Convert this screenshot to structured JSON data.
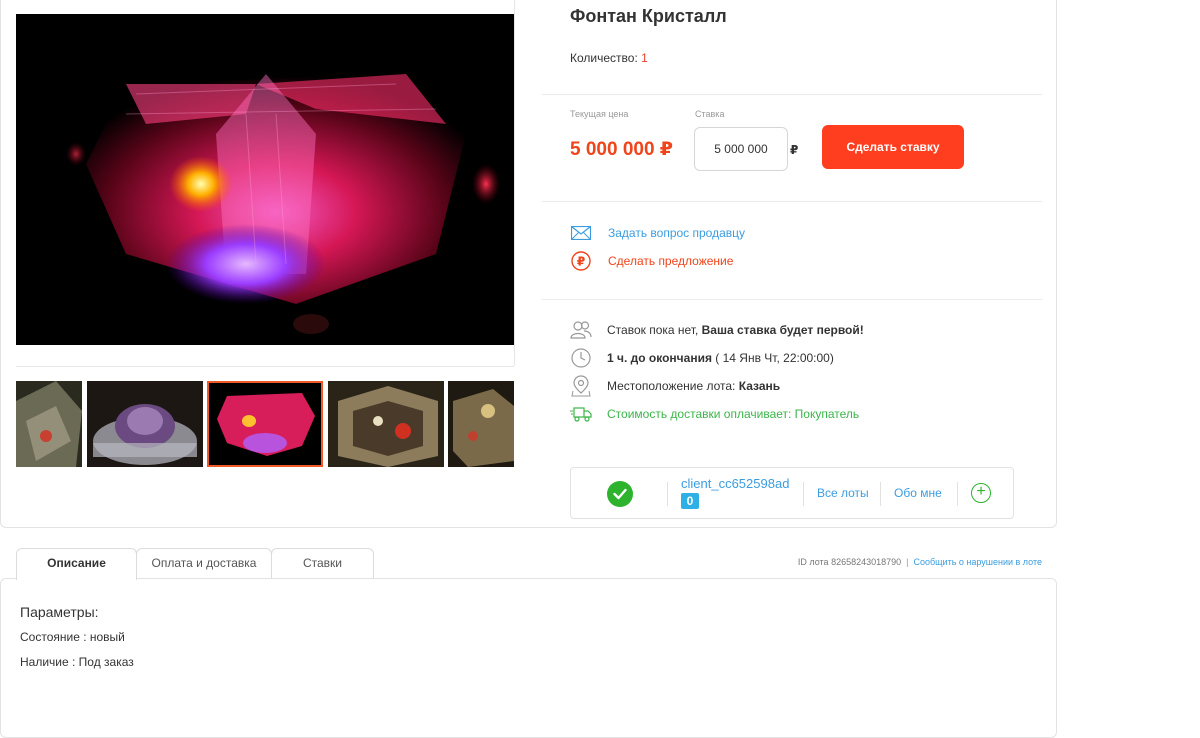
{
  "lot": {
    "title": "Фонтан Кристалл",
    "quantity_label": "Количество:",
    "quantity_value": "1"
  },
  "pricing": {
    "current_price_label": "Текущая цена",
    "current_price": "5 000 000 ₽",
    "bid_label": "Ставка",
    "bid_value": "5 000 000",
    "currency": "₽",
    "bid_button": "Сделать ставку"
  },
  "actions": {
    "ask_seller": "Задать вопрос продавцу",
    "make_offer": "Сделать предложение"
  },
  "info": {
    "bids_prefix": "Ставок пока нет,",
    "bids_bold": "Ваша ставка будет первой!",
    "time_bold": "1 ч. до окончания",
    "time_rest": "( 14 Янв Чт, 22:00:00)",
    "location_prefix": "Местоположение лота:",
    "location_value": "Казань",
    "delivery": "Стоимость доставки оплачивает: Покупатель"
  },
  "seller": {
    "username": "client_cc652598ad",
    "rating": "0",
    "all_lots": "Все лоты",
    "about": "Обо мне"
  },
  "tabs": [
    {
      "label": "Описание",
      "active": true
    },
    {
      "label": "Оплата и доставка",
      "active": false
    },
    {
      "label": "Ставки",
      "active": false
    }
  ],
  "lot_meta": {
    "id_text": "ID лота 82658243018790",
    "separator": "|",
    "report": "Сообщить о нарушении в лоте"
  },
  "description": {
    "heading": "Параметры:",
    "lines": [
      "Состояние : новый",
      "Наличие : Под заказ"
    ]
  },
  "colors": {
    "accent": "#ff3d1f",
    "price": "#f0441b",
    "link": "#3b9de0",
    "success": "#2db32d"
  }
}
